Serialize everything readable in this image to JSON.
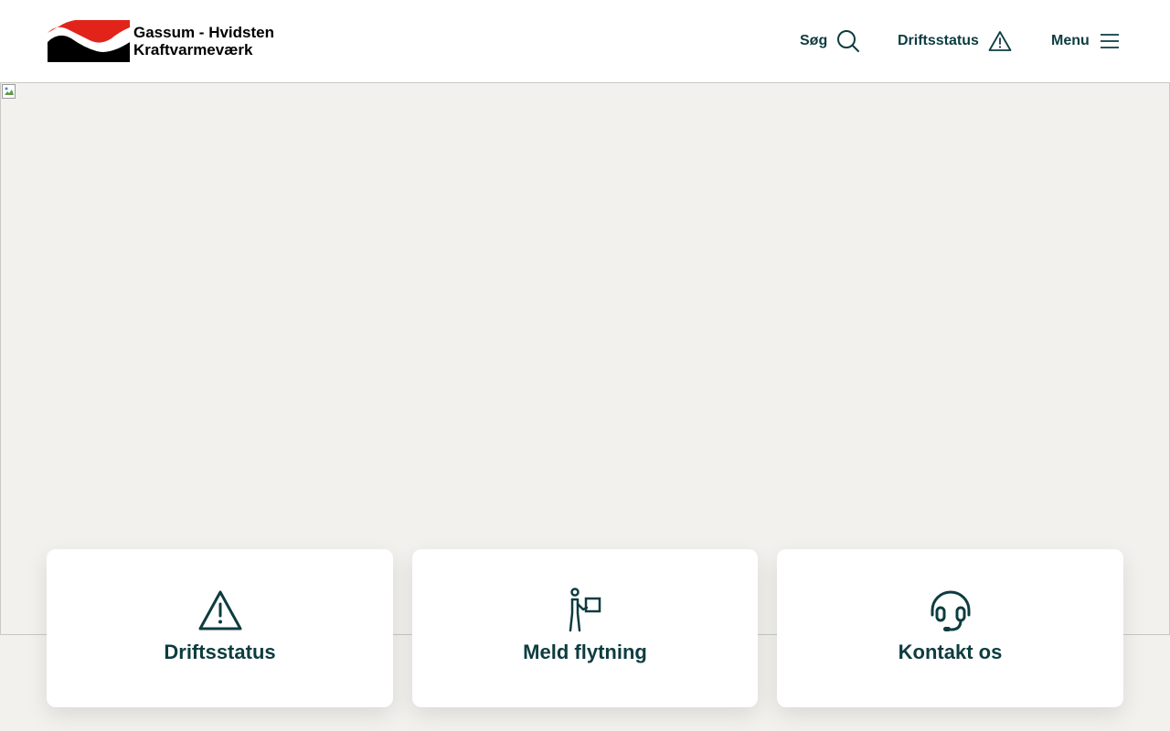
{
  "header": {
    "logo": {
      "line1": "Gassum - Hvidsten",
      "line2": "Kraftvarmeværk",
      "icon": "logo-wave-mark",
      "brand_colors": {
        "red": "#e2231a",
        "black": "#000000"
      }
    },
    "nav": {
      "search_label": "Søg",
      "search_icon": "search-icon",
      "status_label": "Driftsstatus",
      "status_icon": "warning-icon",
      "menu_label": "Menu",
      "menu_icon": "hamburger-icon"
    }
  },
  "hero": {
    "image_state": "broken-image"
  },
  "cards": [
    {
      "label": "Driftsstatus",
      "icon": "warning-icon"
    },
    {
      "label": "Meld flytning",
      "icon": "person-moving-box-icon"
    },
    {
      "label": "Kontakt os",
      "icon": "headset-icon"
    }
  ],
  "colors": {
    "primary": "#0d3c40",
    "background": "#f2f1ed",
    "card": "#ffffff"
  }
}
